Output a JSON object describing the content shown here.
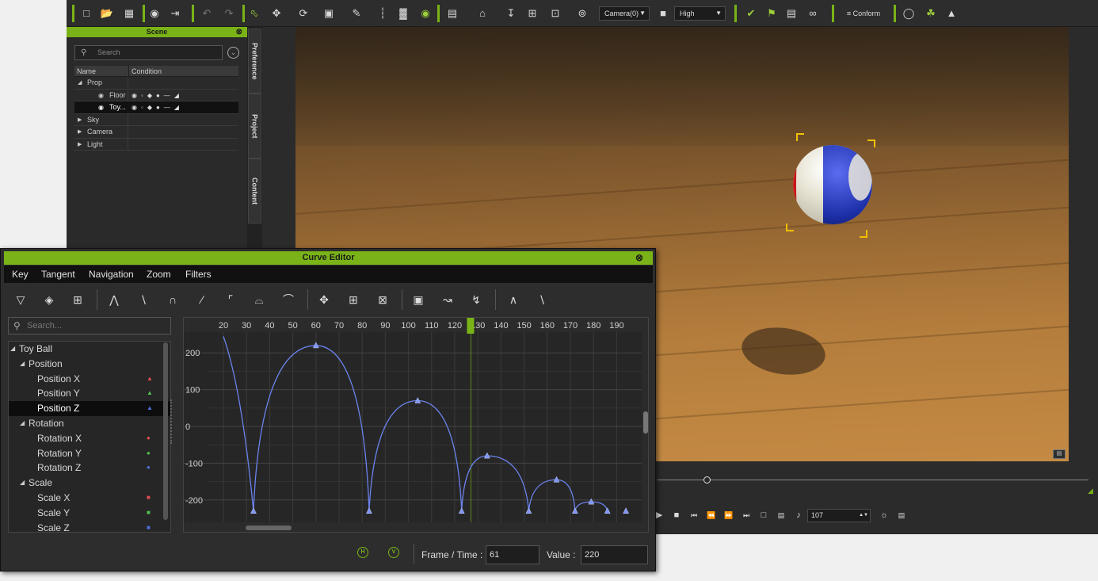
{
  "toolbar": {
    "camera_select": "Camera(0)",
    "quality_select": "High",
    "conform_label": "Conform"
  },
  "scene_panel": {
    "title": "Scene",
    "search_placeholder": "Search",
    "columns": [
      "Name",
      "Condition"
    ],
    "rows": [
      {
        "label": "Prop",
        "expanded": true,
        "level": 0
      },
      {
        "label": "Floor",
        "level": 1
      },
      {
        "label": "Toy...",
        "level": 1,
        "selected": true
      },
      {
        "label": "Sky",
        "level": 0
      },
      {
        "label": "Camera",
        "level": 0
      },
      {
        "label": "Light",
        "level": 0
      }
    ],
    "side_tabs": [
      "Preference",
      "Project",
      "Content"
    ]
  },
  "playback": {
    "frame_value": "107"
  },
  "curve_editor": {
    "title": "Curve Editor",
    "menu": [
      "Key",
      "Tangent",
      "Navigation",
      "Zoom",
      "Filters"
    ],
    "search_placeholder": "Search...",
    "tree": [
      {
        "label": "Toy Ball",
        "level": 0
      },
      {
        "label": "Position",
        "level": 1
      },
      {
        "label": "Position X",
        "level": 2,
        "marker": "triangle",
        "color": "#e05050"
      },
      {
        "label": "Position Y",
        "level": 2,
        "marker": "triangle",
        "color": "#50c050"
      },
      {
        "label": "Position Z",
        "level": 2,
        "marker": "triangle",
        "color": "#5070e0",
        "selected": true
      },
      {
        "label": "Rotation",
        "level": 1
      },
      {
        "label": "Rotation X",
        "level": 2,
        "marker": "circle",
        "color": "#e05050"
      },
      {
        "label": "Rotation Y",
        "level": 2,
        "marker": "circle",
        "color": "#50c050"
      },
      {
        "label": "Rotation Z",
        "level": 2,
        "marker": "circle",
        "color": "#5070e0"
      },
      {
        "label": "Scale",
        "level": 1
      },
      {
        "label": "Scale X",
        "level": 2,
        "marker": "square",
        "color": "#e05050"
      },
      {
        "label": "Scale Y",
        "level": 2,
        "marker": "square",
        "color": "#50c050"
      },
      {
        "label": "Scale Z",
        "level": 2,
        "marker": "square",
        "color": "#5070e0"
      }
    ],
    "x_ticks": [
      "20",
      "30",
      "40",
      "50",
      "60",
      "70",
      "80",
      "90",
      "100",
      "110",
      "120",
      "130",
      "140",
      "150",
      "160",
      "170",
      "180",
      "190"
    ],
    "y_ticks": [
      "200",
      "100",
      "0",
      "-100",
      "-200"
    ],
    "current_frame": 127,
    "frame_time_label": "Frame / Time :",
    "frame_time_value": "61",
    "value_label": "Value :",
    "value_value": "220",
    "curve_keys": [
      {
        "frame": 33,
        "value": -230
      },
      {
        "frame": 60,
        "value": 220
      },
      {
        "frame": 83,
        "value": -230
      },
      {
        "frame": 104,
        "value": 70
      },
      {
        "frame": 123,
        "value": -230
      },
      {
        "frame": 134,
        "value": -80
      },
      {
        "frame": 152,
        "value": -230
      },
      {
        "frame": 164,
        "value": -145
      },
      {
        "frame": 172,
        "value": -230
      },
      {
        "frame": 179,
        "value": -205
      },
      {
        "frame": 186,
        "value": -230
      },
      {
        "frame": 194,
        "value": -230
      }
    ]
  }
}
